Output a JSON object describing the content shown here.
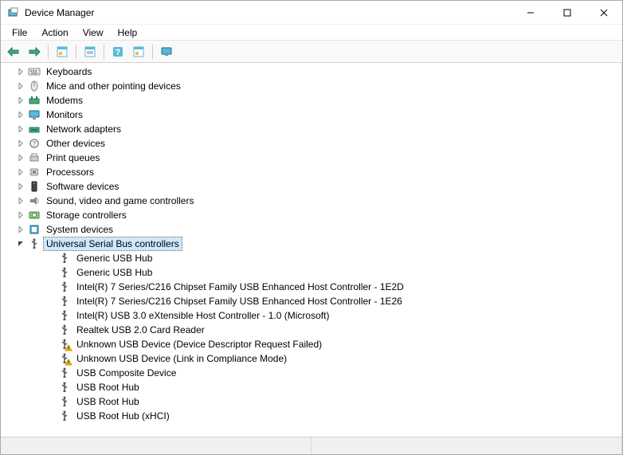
{
  "window": {
    "title": "Device Manager"
  },
  "menu": {
    "file": "File",
    "action": "Action",
    "view": "View",
    "help": "Help"
  },
  "tree": {
    "categories": [
      {
        "label": "Keyboards",
        "icon": "keyboard",
        "expanded": false
      },
      {
        "label": "Mice and other pointing devices",
        "icon": "mouse",
        "expanded": false
      },
      {
        "label": "Modems",
        "icon": "modem",
        "expanded": false
      },
      {
        "label": "Monitors",
        "icon": "monitor",
        "expanded": false
      },
      {
        "label": "Network adapters",
        "icon": "network",
        "expanded": false
      },
      {
        "label": "Other devices",
        "icon": "other",
        "expanded": false
      },
      {
        "label": "Print queues",
        "icon": "printer",
        "expanded": false
      },
      {
        "label": "Processors",
        "icon": "cpu",
        "expanded": false
      },
      {
        "label": "Software devices",
        "icon": "software",
        "expanded": false
      },
      {
        "label": "Sound, video and game controllers",
        "icon": "sound",
        "expanded": false
      },
      {
        "label": "Storage controllers",
        "icon": "storage",
        "expanded": false
      },
      {
        "label": "System devices",
        "icon": "system",
        "expanded": false
      },
      {
        "label": "Universal Serial Bus controllers",
        "icon": "usb",
        "expanded": true,
        "selected": true
      }
    ],
    "usb_children": [
      {
        "label": "Generic USB Hub",
        "icon": "usb",
        "warn": false
      },
      {
        "label": "Generic USB Hub",
        "icon": "usb",
        "warn": false
      },
      {
        "label": "Intel(R) 7 Series/C216 Chipset Family USB Enhanced Host Controller - 1E2D",
        "icon": "usb",
        "warn": false
      },
      {
        "label": "Intel(R) 7 Series/C216 Chipset Family USB Enhanced Host Controller - 1E26",
        "icon": "usb",
        "warn": false
      },
      {
        "label": "Intel(R) USB 3.0 eXtensible Host Controller - 1.0 (Microsoft)",
        "icon": "usb",
        "warn": false
      },
      {
        "label": "Realtek USB 2.0 Card Reader",
        "icon": "usb",
        "warn": false
      },
      {
        "label": "Unknown USB Device (Device Descriptor Request Failed)",
        "icon": "usb",
        "warn": true
      },
      {
        "label": "Unknown USB Device (Link in Compliance Mode)",
        "icon": "usb",
        "warn": true
      },
      {
        "label": "USB Composite Device",
        "icon": "usb",
        "warn": false
      },
      {
        "label": "USB Root Hub",
        "icon": "usb",
        "warn": false
      },
      {
        "label": "USB Root Hub",
        "icon": "usb",
        "warn": false
      },
      {
        "label": "USB Root Hub (xHCI)",
        "icon": "usb",
        "warn": false
      }
    ]
  }
}
